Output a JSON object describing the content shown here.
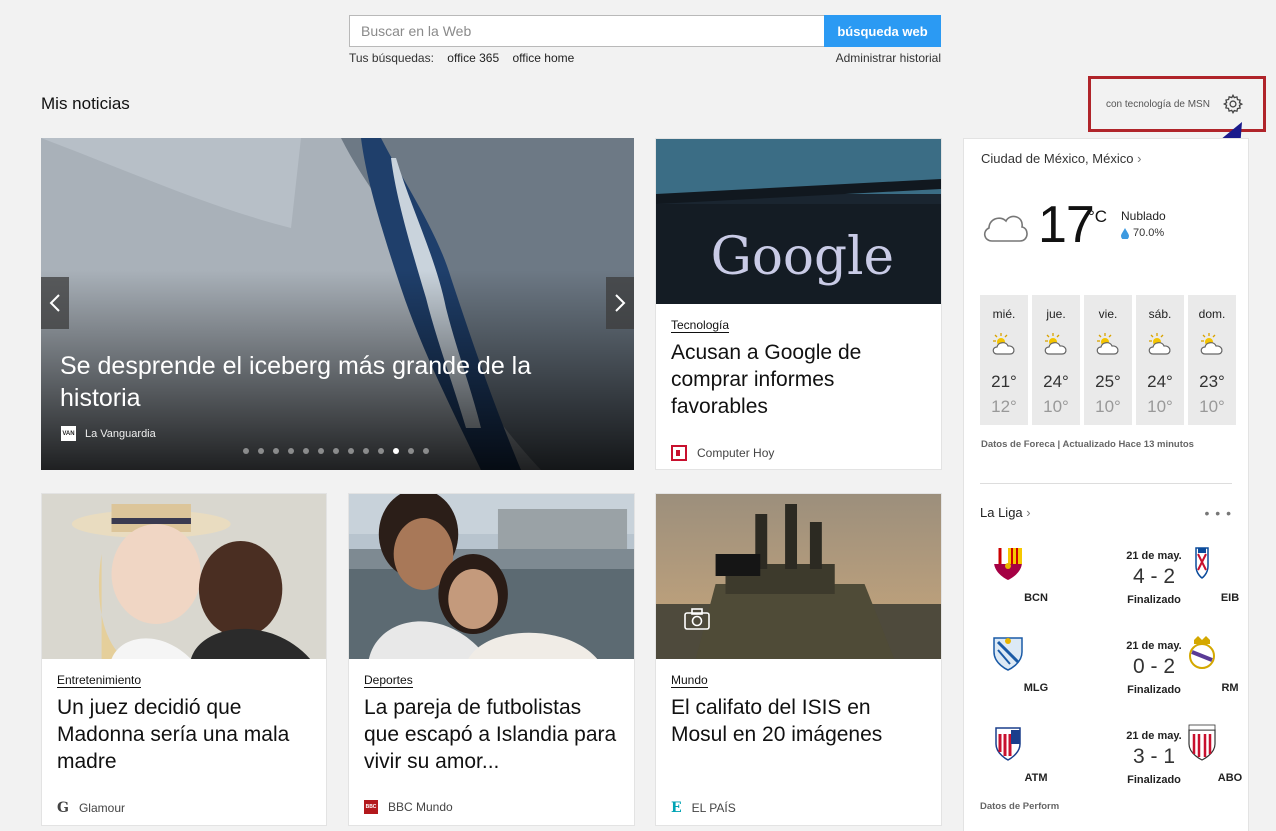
{
  "search": {
    "placeholder": "Buscar en la Web",
    "button": "búsqueda web",
    "history_label": "Tus búsquedas:",
    "history": [
      "office 365",
      "office home"
    ],
    "manage": "Administrar historial"
  },
  "header": {
    "title": "Mis noticias",
    "powered_by": "con tecnología de MSN"
  },
  "hero": {
    "title": "Se desprende el iceberg más grande de la historia",
    "source": "La Vanguardia",
    "source_logo": "VAN",
    "slides": 13,
    "active_slide": 10
  },
  "cards": [
    {
      "category": "Tecnología",
      "title": "Acusan a Google de comprar informes favorables",
      "source": "Computer Hoy",
      "image_text": "Google"
    },
    {
      "category": "Entretenimiento",
      "title": "Un juez decidió que Madonna sería una mala madre",
      "source": "Glamour",
      "source_logo": "G"
    },
    {
      "category": "Deportes",
      "title": "La pareja de futbolistas que escapó a Islandia para vivir su amor...",
      "source": "BBC Mundo",
      "source_logo": "BBC"
    },
    {
      "category": "Mundo",
      "title": "El califato del ISIS en Mosul en 20 imágenes",
      "source": "EL PAÍS",
      "source_logo": "E"
    }
  ],
  "weather": {
    "city": "Ciudad de México, México",
    "temp": "17",
    "unit": "°C",
    "condition": "Nublado",
    "humidity": "70.0%",
    "forecast": [
      {
        "day": "mié.",
        "hi": "21°",
        "lo": "12°"
      },
      {
        "day": "jue.",
        "hi": "24°",
        "lo": "10°"
      },
      {
        "day": "vie.",
        "hi": "25°",
        "lo": "10°"
      },
      {
        "day": "sáb.",
        "hi": "24°",
        "lo": "10°"
      },
      {
        "day": "dom.",
        "hi": "23°",
        "lo": "10°"
      }
    ],
    "credit": "Datos de Foreca | Actualizado Hace 13 minutos"
  },
  "liga": {
    "title": "La Liga",
    "more": "• • •",
    "matches": [
      {
        "home": "BCN",
        "away": "EIB",
        "date": "21 de may.",
        "score": "4 - 2",
        "status": "Finalizado"
      },
      {
        "home": "MLG",
        "away": "RM",
        "date": "21 de may.",
        "score": "0 - 2",
        "status": "Finalizado"
      },
      {
        "home": "ATM",
        "away": "ABO",
        "date": "21 de may.",
        "score": "3 - 1",
        "status": "Finalizado"
      }
    ],
    "credit": "Datos de Perform"
  },
  "colors": {
    "accent": "#2b9af3",
    "highlight": "#b0242a",
    "arrow": "#1a1a8c"
  }
}
